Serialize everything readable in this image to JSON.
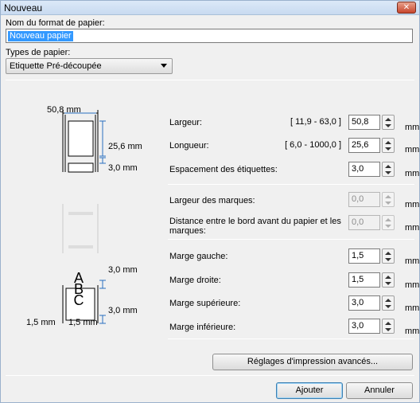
{
  "window": {
    "title": "Nouveau",
    "close_glyph": "✕"
  },
  "paper_name": {
    "label": "Nom du format de papier:",
    "value": "Nouveau papier"
  },
  "paper_type": {
    "label": "Types de papier:",
    "selected": "Etiquette Pré-découpée"
  },
  "diagram": {
    "width_dim": "50,8 mm",
    "length_dim": "25,6 mm",
    "spacing_dim": "3,0 mm",
    "margin_top_dim": "3,0 mm",
    "margin_bottom_dim": "3,0 mm",
    "margin_left_dim": "1,5 mm",
    "margin_right_dim": "1,5 mm",
    "letters": [
      "A",
      "B",
      "C"
    ]
  },
  "fields": {
    "largeur": {
      "label": "Largeur:",
      "range": "[ 11,9 - 63,0 ]",
      "value": "50,8",
      "unit": "mm"
    },
    "longueur": {
      "label": "Longueur:",
      "range": "[ 6,0 - 1000,0 ]",
      "value": "25,6",
      "unit": "mm"
    },
    "espacement": {
      "label": "Espacement des étiquettes:",
      "value": "3,0",
      "unit": "mm"
    },
    "largeur_marques": {
      "label": "Largeur des marques:",
      "value": "0,0",
      "unit": "mm"
    },
    "distance_marques": {
      "label_line1": "Distance entre le bord avant du papier et les",
      "label_line2": "marques:",
      "value": "0,0",
      "unit": "mm"
    },
    "marge_gauche": {
      "label": "Marge gauche:",
      "value": "1,5",
      "unit": "mm"
    },
    "marge_droite": {
      "label": "Marge droite:",
      "value": "1,5",
      "unit": "mm"
    },
    "marge_superieure": {
      "label": "Marge supérieure:",
      "value": "3,0",
      "unit": "mm"
    },
    "marge_inferieure": {
      "label": "Marge inférieure:",
      "value": "3,0",
      "unit": "mm"
    }
  },
  "buttons": {
    "advanced": "Réglages d'impression avancés...",
    "add": "Ajouter",
    "cancel": "Annuler"
  }
}
